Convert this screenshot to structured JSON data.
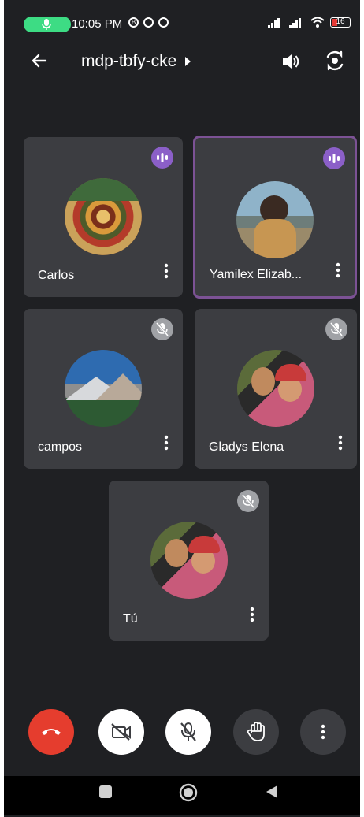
{
  "status_bar": {
    "time": "10:05 PM",
    "battery": "16",
    "icons": [
      "mic-active-icon",
      "b-icon",
      "chrome-icon",
      "chrome-icon",
      "signal-icon",
      "signal-icon",
      "wifi-icon",
      "battery-icon"
    ]
  },
  "header": {
    "meeting_code": "mdp-tbfy-cke",
    "back_icon": "back-arrow-icon",
    "audio_icon": "speaker-icon",
    "flip_icon": "switch-camera-icon"
  },
  "participants": [
    {
      "name": "Carlos",
      "state": "speaking",
      "avatar": "food-mandala-photo"
    },
    {
      "name": "Yamilex Elizab...",
      "state": "speaking",
      "active": true,
      "avatar": "woman-sunglasses-photo"
    },
    {
      "name": "campos",
      "state": "muted",
      "avatar": "mountain-lake-photo"
    },
    {
      "name": "Gladys Elena",
      "state": "muted",
      "avatar": "mother-child-photo"
    },
    {
      "name": "Tú",
      "state": "muted",
      "avatar": "mother-child-photo"
    }
  ],
  "controls": [
    {
      "name": "end-call",
      "icon": "phone-hangup-icon"
    },
    {
      "name": "camera-off",
      "icon": "video-off-icon"
    },
    {
      "name": "mic-off",
      "icon": "mic-off-icon"
    },
    {
      "name": "raise-hand",
      "icon": "hand-icon"
    },
    {
      "name": "more-options",
      "icon": "more-vertical-icon"
    }
  ],
  "colors": {
    "background": "#1f2023",
    "tile": "#3c3d41",
    "active_border": "#7c5295",
    "speaking_badge": "#8b5fc8",
    "hangup": "#e53d2e"
  }
}
